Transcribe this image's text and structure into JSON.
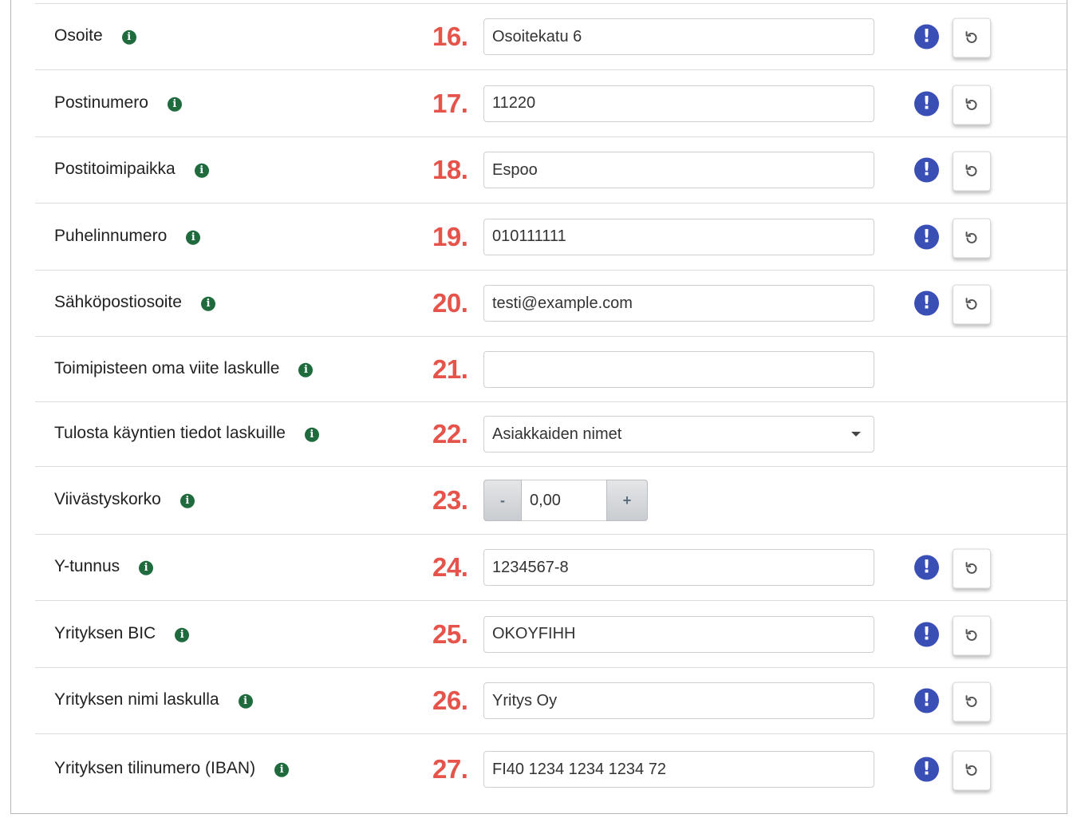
{
  "rows": [
    {
      "label": "Osoite",
      "number": "16.",
      "value": "Osoitekatu 6"
    },
    {
      "label": "Postinumero",
      "number": "17.",
      "value": "11220"
    },
    {
      "label": "Postitoimipaikka",
      "number": "18.",
      "value": "Espoo"
    },
    {
      "label": "Puhelinnumero",
      "number": "19.",
      "value": "010111111"
    },
    {
      "label": "Sähköpostiosoite",
      "number": "20.",
      "value": "testi@example.com"
    },
    {
      "label": "Toimipisteen oma viite laskulle",
      "number": "21.",
      "value": ""
    },
    {
      "label": "Tulosta käyntien tiedot laskuille",
      "number": "22.",
      "value": "Asiakkaiden nimet"
    },
    {
      "label": "Viivästyskorko",
      "number": "23.",
      "value": "0,00",
      "minus": "-",
      "plus": "+"
    },
    {
      "label": "Y-tunnus",
      "number": "24.",
      "value": "1234567-8"
    },
    {
      "label": "Yrityksen BIC",
      "number": "25.",
      "value": "OKOYFIHH"
    },
    {
      "label": "Yrityksen nimi laskulla",
      "number": "26.",
      "value": "Yritys Oy"
    },
    {
      "label": "Yrityksen tilinumero (IBAN)",
      "number": "27.",
      "value": "FI40 1234 1234 1234 72"
    }
  ],
  "icons": {
    "info": "i",
    "alert": "!",
    "reset": "reset-icon"
  },
  "colors": {
    "number": "#e5534b",
    "info": "#1f6b3e",
    "alert": "#3a4fb5"
  }
}
